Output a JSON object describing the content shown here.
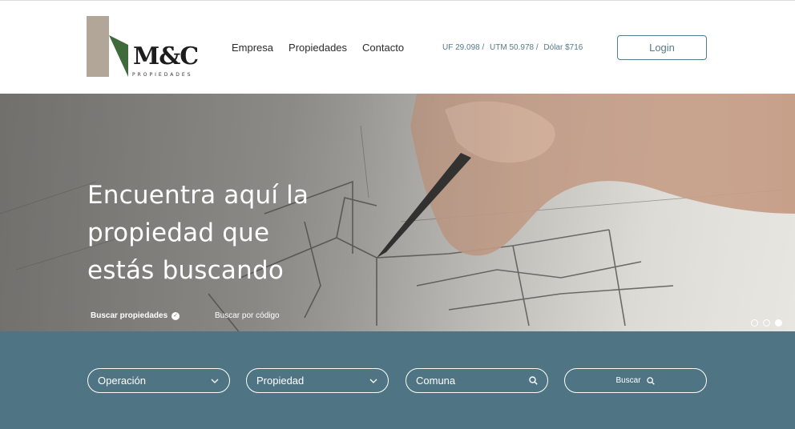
{
  "brand": {
    "name": "M&C",
    "subtitle": "PROPIEDADES",
    "colors": {
      "beige": "#b2a698",
      "green": "#3f6b3c"
    }
  },
  "nav": {
    "items": [
      {
        "label": "Empresa"
      },
      {
        "label": "Propiedades"
      },
      {
        "label": "Contacto"
      }
    ]
  },
  "rates": {
    "uf": "UF 29.098 /",
    "utm": "UTM 50.978 /",
    "dolar": "Dólar $716"
  },
  "header": {
    "login_label": "Login"
  },
  "hero": {
    "title": "Encuentra aquí la propiedad que estás buscando",
    "tab_search": "Buscar propiedades",
    "tab_code": "Buscar por código",
    "slides": 3,
    "active_slide": 3
  },
  "search": {
    "operation": "Operación",
    "property": "Propiedad",
    "comuna": "Comuna",
    "button": "Buscar",
    "band_color": "#4f7585"
  },
  "icons": {
    "operation": "chevron-down-icon",
    "property": "chevron-down-icon",
    "comuna": "search-icon",
    "button": "search-icon"
  }
}
